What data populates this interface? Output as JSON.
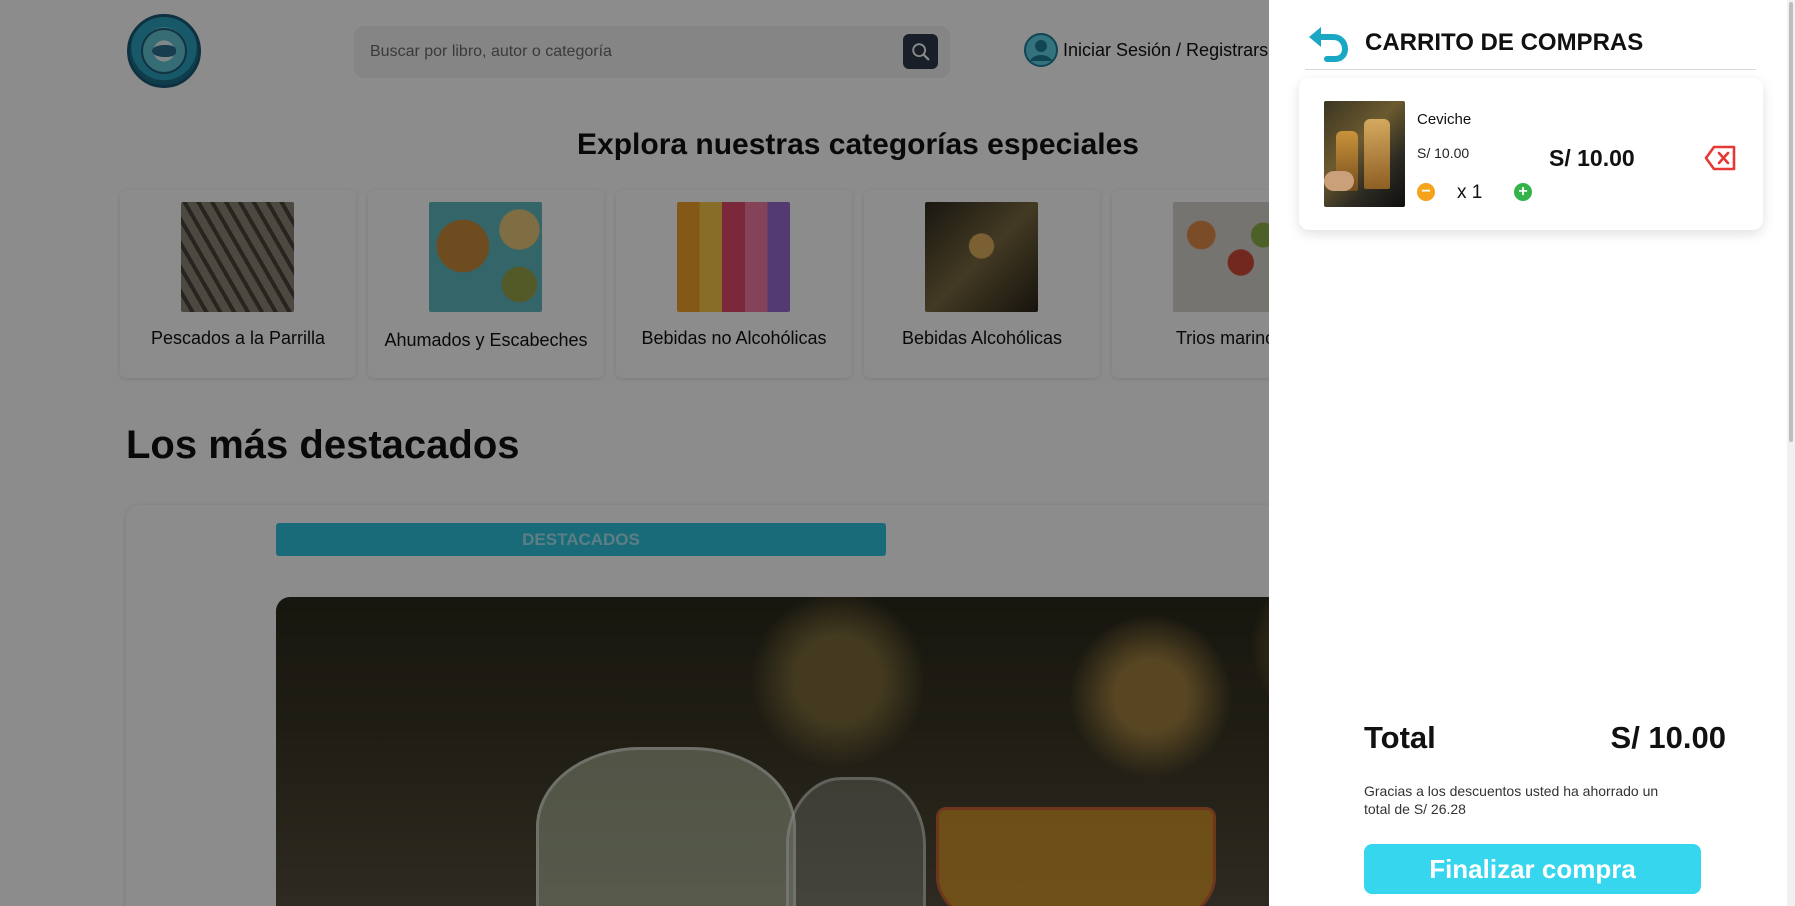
{
  "header": {
    "logo_alt": "Cevichería Brisas Marina",
    "search_placeholder": "Buscar por libro, autor o categoría",
    "login_label": "Iniciar Sesión / Registrarse"
  },
  "categories": {
    "title": "Explora nuestras categorías especiales",
    "items": [
      {
        "label": "Pescados a la Parrilla"
      },
      {
        "label": "Ahumados y Escabeches"
      },
      {
        "label": "Bebidas no Alcohólicas"
      },
      {
        "label": "Bebidas Alcohólicas"
      },
      {
        "label": "Trios marinos"
      }
    ]
  },
  "featured": {
    "title": "Los más destacados",
    "tab_label": "DESTACADOS"
  },
  "cart": {
    "title": "CARRITO DE COMPRAS",
    "items": [
      {
        "name": "Ceviche",
        "unit_price": "S/ 10.00",
        "total": "S/ 10.00",
        "quantity": "x 1"
      }
    ],
    "total_label": "Total",
    "total_value": "S/ 10.00",
    "savings_text": "Gracias a los descuentos usted ha ahorrado un total de S/ 26.28",
    "checkout_label": "Finalizar compra"
  },
  "colors": {
    "accent": "#36d6ee",
    "tab": "#2ec4df",
    "qty_minus": "#f4a31b",
    "qty_plus": "#34b34a",
    "remove": "#e53935"
  },
  "icons": {
    "search": "search-icon",
    "user": "user-icon",
    "back": "back-arrow-icon",
    "minus": "minus-circle-icon",
    "plus": "plus-circle-icon",
    "remove": "backspace-icon"
  }
}
